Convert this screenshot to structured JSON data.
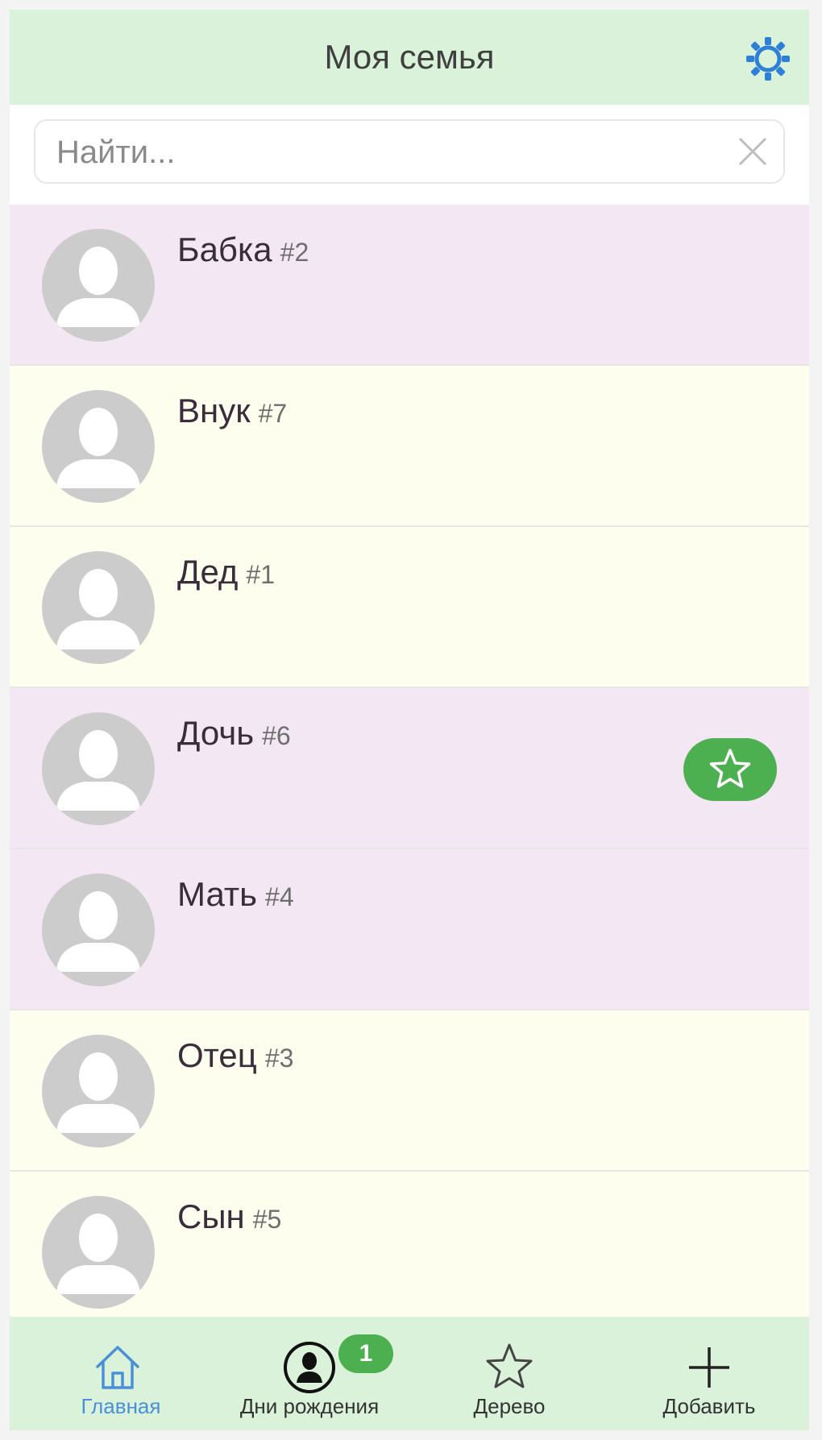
{
  "header": {
    "title": "Моя семья",
    "settings_icon": "gear-icon",
    "accent_color": "#2e7fd6",
    "background": "#daf2d9"
  },
  "search": {
    "placeholder": "Найти...",
    "value": "",
    "clear_icon": "close-icon"
  },
  "people": [
    {
      "name": "Бабка",
      "id": "#2",
      "bg": "#f3e7f3",
      "favorite": false
    },
    {
      "name": "Внук",
      "id": "#7",
      "bg": "#fdfeee",
      "favorite": false
    },
    {
      "name": "Дед",
      "id": "#1",
      "bg": "#fdfeee",
      "favorite": false
    },
    {
      "name": "Дочь",
      "id": "#6",
      "bg": "#f3e7f3",
      "favorite": true
    },
    {
      "name": "Мать",
      "id": "#4",
      "bg": "#f3e7f3",
      "favorite": false
    },
    {
      "name": "Отец",
      "id": "#3",
      "bg": "#fdfeee",
      "favorite": false
    },
    {
      "name": "Сын",
      "id": "#5",
      "bg": "#fdfeee",
      "favorite": false
    }
  ],
  "colors": {
    "female_row": "#f3e7f3",
    "male_row": "#fdfeee",
    "favorite_badge": "#4caf50",
    "active_tab": "#4a90d9"
  },
  "tabbar": {
    "tabs": [
      {
        "label": "Главная",
        "icon": "home-icon",
        "active": true
      },
      {
        "label": "Дни рождения",
        "icon": "person-circle-icon",
        "badge": "1"
      },
      {
        "label": "Дерево",
        "icon": "star-outline-icon"
      },
      {
        "label": "Добавить",
        "icon": "plus-icon"
      }
    ]
  }
}
